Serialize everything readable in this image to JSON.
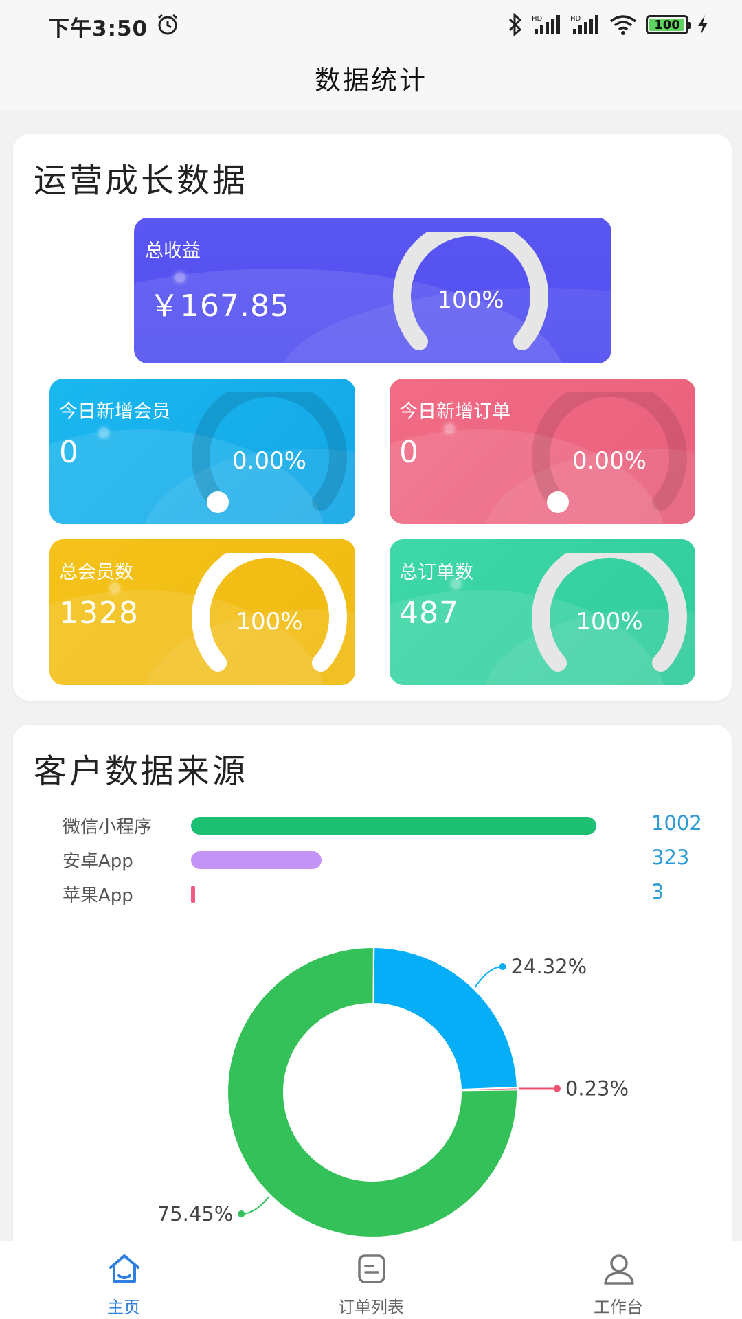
{
  "status_bar": {
    "time": "下午3:50",
    "battery": "100"
  },
  "header": {
    "title": "数据统计"
  },
  "growth": {
    "title": "运营成长数据",
    "cards": {
      "total_revenue": {
        "label": "总收益",
        "value": "￥167.85",
        "percent": "100%"
      },
      "new_members_today": {
        "label": "今日新增会员",
        "value": "0",
        "percent": "0.00%"
      },
      "new_orders_today": {
        "label": "今日新增订单",
        "value": "0",
        "percent": "0.00%"
      },
      "total_members": {
        "label": "总会员数",
        "value": "1328",
        "percent": "100%"
      },
      "total_orders": {
        "label": "总订单数",
        "value": "487",
        "percent": "100%"
      }
    }
  },
  "sources": {
    "title": "客户数据来源",
    "bars": [
      {
        "label": "微信小程序",
        "value": "1002",
        "amount": 1002,
        "color": "#1dbf73"
      },
      {
        "label": "安卓App",
        "value": "323",
        "amount": 323,
        "color": "#c393f5"
      },
      {
        "label": "苹果App",
        "value": "3",
        "amount": 3,
        "color": "#f05a7e"
      }
    ],
    "bar_max": 1002
  },
  "chart_data": {
    "type": "pie",
    "labels": [
      "75.45%",
      "24.32%",
      "0.23%"
    ],
    "values": [
      75.45,
      24.32,
      0.23
    ],
    "colors": [
      "#34c159",
      "#06aef8",
      "#ee5070"
    ]
  },
  "tabs": [
    {
      "label": "主页",
      "icon": "home-icon",
      "active": true
    },
    {
      "label": "订单列表",
      "icon": "order-list-icon",
      "active": false
    },
    {
      "label": "工作台",
      "icon": "user-icon",
      "active": false
    }
  ]
}
